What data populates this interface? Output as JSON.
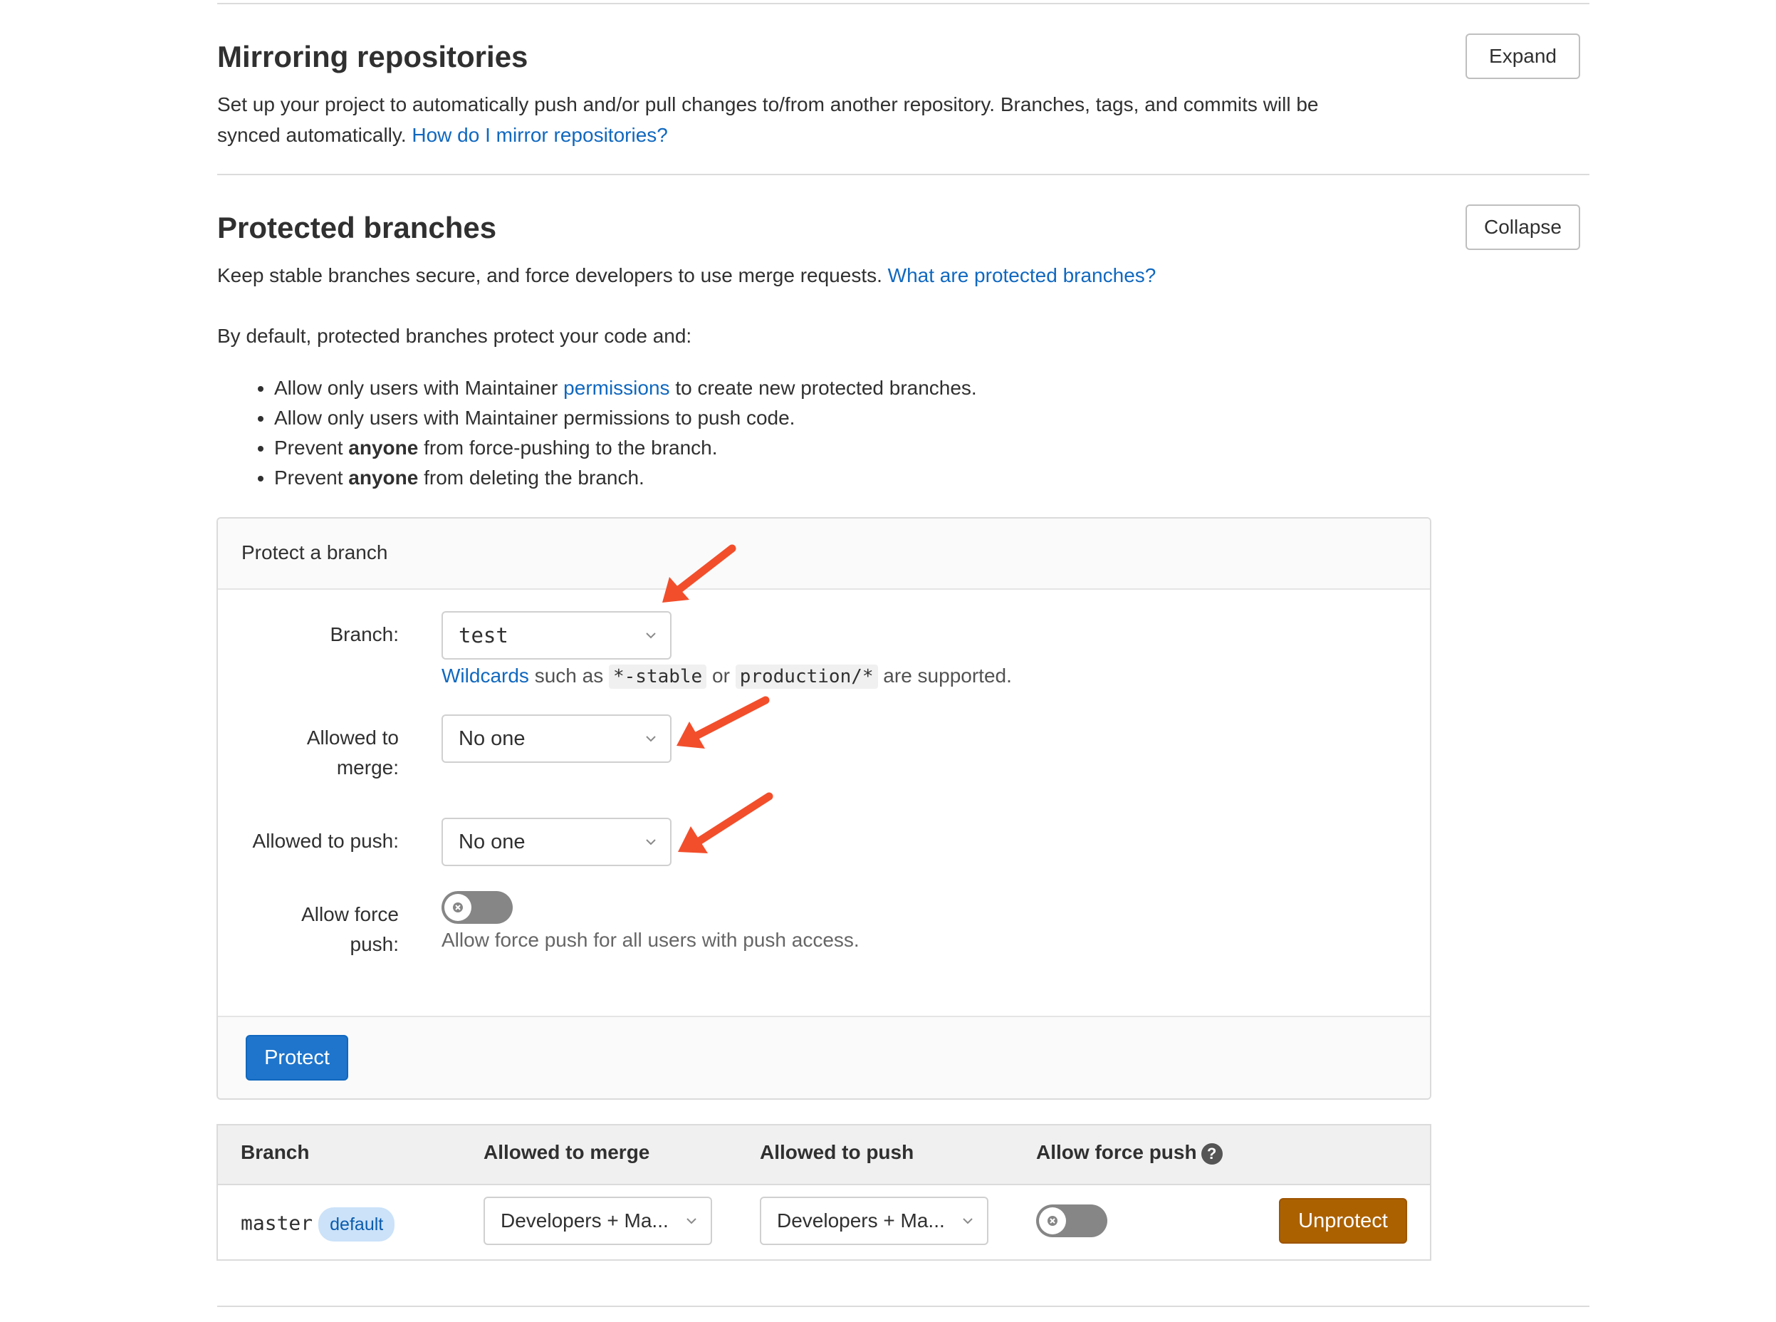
{
  "mirroring": {
    "title": "Mirroring repositories",
    "desc_line1": "Set up your project to automatically push and/or pull changes to/from another repository. Branches, tags, and commits will be",
    "desc_line2": "synced automatically.",
    "help_link": "How do I mirror repositories?",
    "expand_label": "Expand"
  },
  "protected": {
    "title": "Protected branches",
    "collapse_label": "Collapse",
    "intro": "Keep stable branches secure, and force developers to use merge requests.",
    "intro_link": "What are protected branches?",
    "default_text": "By default, protected branches protect your code and:",
    "bullets": {
      "b1_pre": "Allow only users with Maintainer ",
      "b1_link": "permissions",
      "b1_post": " to create new protected branches.",
      "b2": "Allow only users with Maintainer permissions to push code.",
      "b3_pre": "Prevent ",
      "b3_bold": "anyone",
      "b3_post": " from force-pushing to the branch.",
      "b4_pre": "Prevent ",
      "b4_bold": "anyone",
      "b4_post": " from deleting the branch."
    }
  },
  "form": {
    "header": "Protect a branch",
    "branch_label": "Branch:",
    "branch_value": "test",
    "hint_link": "Wildcards",
    "hint_such": " such as ",
    "hint_code1": "*-stable",
    "hint_or": " or ",
    "hint_code2": "production/*",
    "hint_end": " are supported.",
    "merge_label_1": "Allowed to",
    "merge_label_2": "merge:",
    "merge_value": "No one",
    "push_label": "Allowed to push:",
    "push_value": "No one",
    "force_label_1": "Allow force",
    "force_label_2": "push:",
    "force_enabled": false,
    "force_help": "Allow force push for all users with push access.",
    "protect_button": "Protect"
  },
  "table": {
    "headers": {
      "branch": "Branch",
      "merge": "Allowed to merge",
      "push": "Allowed to push",
      "force": "Allow force push"
    },
    "rows": [
      {
        "branch": "master",
        "badge": "default",
        "merge": "Developers + Ma...",
        "push": "Developers + Ma...",
        "force_enabled": false,
        "action": "Unprotect"
      }
    ]
  },
  "annotations": {
    "arrow_color": "#f24e2b"
  }
}
